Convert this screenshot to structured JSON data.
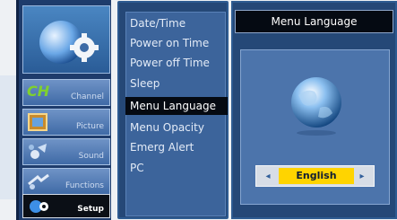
{
  "sidebar": {
    "items": [
      {
        "label": "Channel",
        "icon": "ch-icon",
        "badge": "CH"
      },
      {
        "label": "Picture",
        "icon": "picture-icon"
      },
      {
        "label": "Sound",
        "icon": "sound-icon"
      },
      {
        "label": "Functions",
        "icon": "functions-icon"
      },
      {
        "label": "Setup",
        "icon": "setup-gear-icon",
        "active": true
      }
    ]
  },
  "setup_menu": {
    "items": [
      "Date/Time",
      "Power  on Time",
      "Power  off Time",
      "Sleep",
      "Menu Language",
      "Menu Opacity",
      "Emerg Alert",
      "PC"
    ],
    "selected_index": 4
  },
  "detail": {
    "title": "Menu Language",
    "current_value": "English",
    "left_arrow": "◂",
    "right_arrow": "▸"
  }
}
